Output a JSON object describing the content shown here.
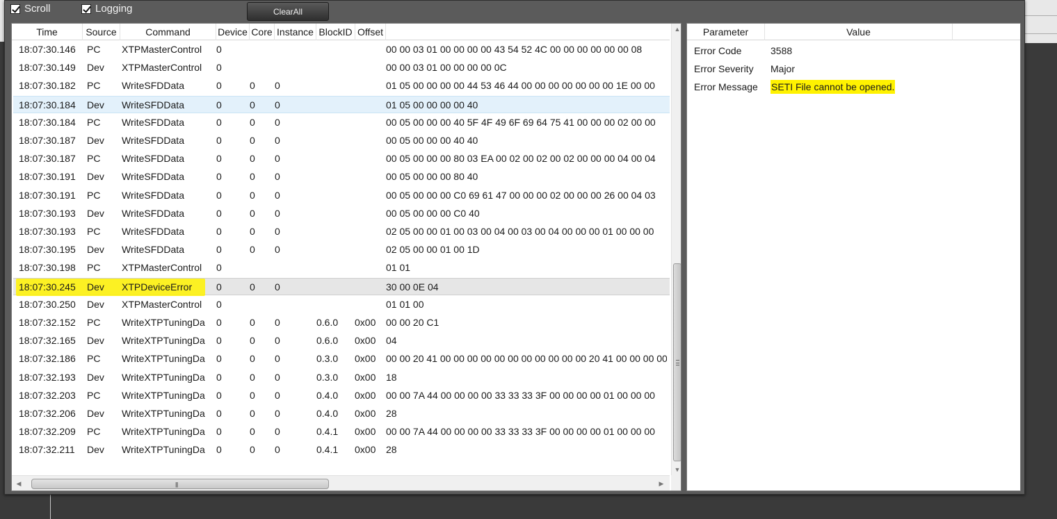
{
  "toolbar": {
    "scroll_label": "Scroll",
    "logging_label": "Logging",
    "clear_all_label": "ClearAll",
    "scroll_checked": true,
    "logging_checked": true
  },
  "log_table": {
    "columns": [
      "Time",
      "Source",
      "Command",
      "Device",
      "Core",
      "Instance",
      "BlockID",
      "Offset"
    ],
    "selected_row": 3,
    "highlighted_row": 13,
    "rows": [
      {
        "time": "18:07:30.146",
        "source": "PC",
        "command": "XTPMasterControl",
        "device": "0",
        "core": "",
        "instance": "",
        "block_id": "",
        "offset": "",
        "data": "00 00 03 01 00 00 00 00 43 54 52 4C 00 00 00 00 00 00 08"
      },
      {
        "time": "18:07:30.149",
        "source": "Dev",
        "command": "XTPMasterControl",
        "device": "0",
        "core": "",
        "instance": "",
        "block_id": "",
        "offset": "",
        "data": "00 00 03 01 00 00 00 00 0C"
      },
      {
        "time": "18:07:30.182",
        "source": "PC",
        "command": "WriteSFDData",
        "device": "0",
        "core": "0",
        "instance": "0",
        "block_id": "",
        "offset": "",
        "data": "01 05 00 00 00 00 44 53 46 44 00 00 00 00 00 00 00 1E 00 00"
      },
      {
        "time": "18:07:30.184",
        "source": "Dev",
        "command": "WriteSFDData",
        "device": "0",
        "core": "0",
        "instance": "0",
        "block_id": "",
        "offset": "",
        "data": "01 05 00 00 00 00 40"
      },
      {
        "time": "18:07:30.184",
        "source": "PC",
        "command": "WriteSFDData",
        "device": "0",
        "core": "0",
        "instance": "0",
        "block_id": "",
        "offset": "",
        "data": "00 05 00 00 00 40 5F 4F 49 6F 69 64 75 41 00 00 00 02 00 00"
      },
      {
        "time": "18:07:30.187",
        "source": "Dev",
        "command": "WriteSFDData",
        "device": "0",
        "core": "0",
        "instance": "0",
        "block_id": "",
        "offset": "",
        "data": "00 05 00 00 00 40 40"
      },
      {
        "time": "18:07:30.187",
        "source": "PC",
        "command": "WriteSFDData",
        "device": "0",
        "core": "0",
        "instance": "0",
        "block_id": "",
        "offset": "",
        "data": "00 05 00 00 00 80 03 EA 00 02 00 02 00 02 00 00 00 04 00 04"
      },
      {
        "time": "18:07:30.191",
        "source": "Dev",
        "command": "WriteSFDData",
        "device": "0",
        "core": "0",
        "instance": "0",
        "block_id": "",
        "offset": "",
        "data": "00 05 00 00 00 80 40"
      },
      {
        "time": "18:07:30.191",
        "source": "PC",
        "command": "WriteSFDData",
        "device": "0",
        "core": "0",
        "instance": "0",
        "block_id": "",
        "offset": "",
        "data": "00 05 00 00 00 C0 69 61 47 00 00 00 02 00 00 00 26 00 04 03"
      },
      {
        "time": "18:07:30.193",
        "source": "Dev",
        "command": "WriteSFDData",
        "device": "0",
        "core": "0",
        "instance": "0",
        "block_id": "",
        "offset": "",
        "data": "00 05 00 00 00 C0 40"
      },
      {
        "time": "18:07:30.193",
        "source": "PC",
        "command": "WriteSFDData",
        "device": "0",
        "core": "0",
        "instance": "0",
        "block_id": "",
        "offset": "",
        "data": "02 05 00 00 01 00 03 00 04 00 03 00 04 00 00 00 01 00 00 00"
      },
      {
        "time": "18:07:30.195",
        "source": "Dev",
        "command": "WriteSFDData",
        "device": "0",
        "core": "0",
        "instance": "0",
        "block_id": "",
        "offset": "",
        "data": "02 05 00 00 01 00 1D"
      },
      {
        "time": "18:07:30.198",
        "source": "PC",
        "command": "XTPMasterControl",
        "device": "0",
        "core": "",
        "instance": "",
        "block_id": "",
        "offset": "",
        "data": "01 01"
      },
      {
        "time": "18:07:30.245",
        "source": "Dev",
        "command": "XTPDeviceError",
        "device": "0",
        "core": "0",
        "instance": "0",
        "block_id": "",
        "offset": "",
        "data": "30 00 0E 04"
      },
      {
        "time": "18:07:30.250",
        "source": "Dev",
        "command": "XTPMasterControl",
        "device": "0",
        "core": "",
        "instance": "",
        "block_id": "",
        "offset": "",
        "data": "01 01 00"
      },
      {
        "time": "18:07:32.152",
        "source": "PC",
        "command": "WriteXTPTuningDa",
        "device": "0",
        "core": "0",
        "instance": "0",
        "block_id": "0.6.0",
        "offset": "0x00",
        "data": "00 00 20 C1"
      },
      {
        "time": "18:07:32.165",
        "source": "Dev",
        "command": "WriteXTPTuningDa",
        "device": "0",
        "core": "0",
        "instance": "0",
        "block_id": "0.6.0",
        "offset": "0x00",
        "data": "04"
      },
      {
        "time": "18:07:32.186",
        "source": "PC",
        "command": "WriteXTPTuningDa",
        "device": "0",
        "core": "0",
        "instance": "0",
        "block_id": "0.3.0",
        "offset": "0x00",
        "data": "00 00 20 41 00 00 00 00 00 00 00 00 00 00 00 20 41 00 00 00 00"
      },
      {
        "time": "18:07:32.193",
        "source": "Dev",
        "command": "WriteXTPTuningDa",
        "device": "0",
        "core": "0",
        "instance": "0",
        "block_id": "0.3.0",
        "offset": "0x00",
        "data": "18"
      },
      {
        "time": "18:07:32.203",
        "source": "PC",
        "command": "WriteXTPTuningDa",
        "device": "0",
        "core": "0",
        "instance": "0",
        "block_id": "0.4.0",
        "offset": "0x00",
        "data": "00 00 7A 44 00 00 00 00 33 33 33 3F 00 00 00 00 01 00 00 00"
      },
      {
        "time": "18:07:32.206",
        "source": "Dev",
        "command": "WriteXTPTuningDa",
        "device": "0",
        "core": "0",
        "instance": "0",
        "block_id": "0.4.0",
        "offset": "0x00",
        "data": "28"
      },
      {
        "time": "18:07:32.209",
        "source": "PC",
        "command": "WriteXTPTuningDa",
        "device": "0",
        "core": "0",
        "instance": "0",
        "block_id": "0.4.1",
        "offset": "0x00",
        "data": "00 00 7A 44 00 00 00 00 33 33 33 3F 00 00 00 00 01 00 00 00"
      },
      {
        "time": "18:07:32.211",
        "source": "Dev",
        "command": "WriteXTPTuningDa",
        "device": "0",
        "core": "0",
        "instance": "0",
        "block_id": "0.4.1",
        "offset": "0x00",
        "data": "28"
      }
    ]
  },
  "param_table": {
    "columns": [
      "Parameter",
      "Value"
    ],
    "rows": [
      {
        "name": "Error Code",
        "value": "3588",
        "marked": false
      },
      {
        "name": "Error Severity",
        "value": "Major",
        "marked": false
      },
      {
        "name": "Error Message",
        "value": "SETI File cannot be opened.",
        "marked": true
      }
    ]
  },
  "colors": {
    "marker": "#fff200",
    "selected_row": "#e3f1fb",
    "window_chrome": "#5b5b5b"
  },
  "icons": {
    "scroll_up": "triangle-up",
    "scroll_down": "triangle-down",
    "scroll_left": "triangle-left",
    "scroll_right": "triangle-right"
  }
}
